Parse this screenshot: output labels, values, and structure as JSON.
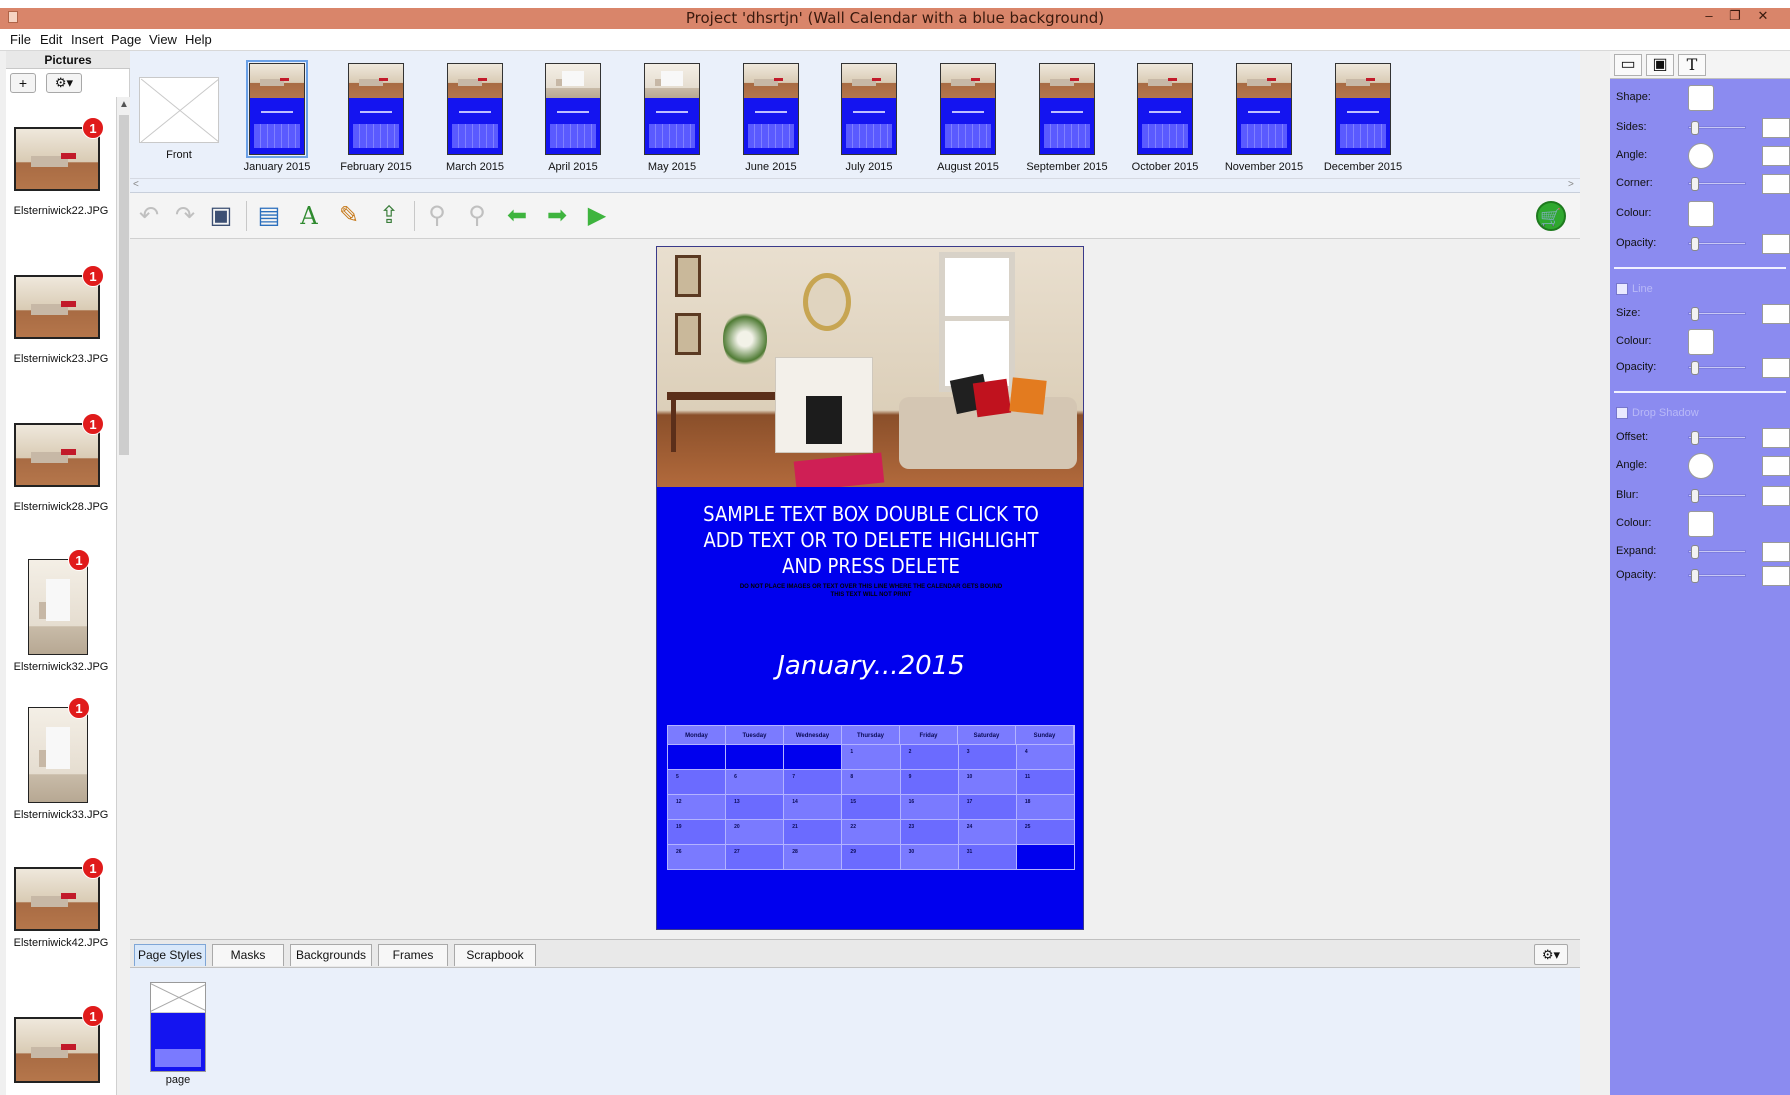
{
  "window": {
    "title": "Project 'dhsrtjn' (Wall Calendar with a blue background)",
    "minimize": "–",
    "restore": "❐",
    "close": "✕"
  },
  "menu": [
    "File",
    "Edit",
    "Insert",
    "Page",
    "View",
    "Help"
  ],
  "pictures": {
    "header": "Pictures",
    "add_label": "+",
    "gear_label": "⚙▾",
    "items": [
      {
        "name": "Elsterniwick22.JPG",
        "badge": "1"
      },
      {
        "name": "Elsterniwick23.JPG",
        "badge": "1"
      },
      {
        "name": "Elsterniwick28.JPG",
        "badge": "1"
      },
      {
        "name": "Elsterniwick32.JPG",
        "badge": "1"
      },
      {
        "name": "Elsterniwick33.JPG",
        "badge": "1"
      },
      {
        "name": "Elsterniwick42.JPG",
        "badge": "1"
      },
      {
        "name": "",
        "badge": "1"
      }
    ]
  },
  "pages": [
    "Front",
    "January 2015",
    "February 2015",
    "March 2015",
    "April 2015",
    "May 2015",
    "June 2015",
    "July 2015",
    "August 2015",
    "September 2015",
    "October 2015",
    "November 2015",
    "December 2015"
  ],
  "selected_page": "January 2015",
  "toolbar": {
    "icons": [
      "undo-icon",
      "redo-icon",
      "save-icon",
      "add-picture-icon",
      "add-text-icon",
      "edit-text-icon",
      "export-icon",
      "zoom-out-icon",
      "zoom-in-icon",
      "previous-page-icon",
      "next-page-icon",
      "play-icon",
      "cart-icon"
    ]
  },
  "calendar_page": {
    "sample_text": "SAMPLE TEXT BOX DOUBLE CLICK TO ADD TEXT OR TO DELETE HIGHLIGHT AND PRESS DELETE",
    "note_line1": "DO NOT PLACE IMAGES OR TEXT OVER THIS LINE WHERE THE CALENDAR GETS BOUND",
    "note_line2": "THIS TEXT WILL NOT PRINT",
    "month_title": "January...2015",
    "weekdays": [
      "Monday",
      "Tuesday",
      "Wednesday",
      "Thursday",
      "Friday",
      "Saturday",
      "Sunday"
    ],
    "weeks": [
      [
        "",
        "",
        "",
        "1",
        "2",
        "3",
        "4"
      ],
      [
        "5",
        "6",
        "7",
        "8",
        "9",
        "10",
        "11"
      ],
      [
        "12",
        "13",
        "14",
        "15",
        "16",
        "17",
        "18"
      ],
      [
        "19",
        "20",
        "21",
        "22",
        "23",
        "24",
        "25"
      ],
      [
        "26",
        "27",
        "28",
        "29",
        "30",
        "31",
        ""
      ]
    ],
    "background_color": "#0000ee"
  },
  "tabs": [
    "Page Styles",
    "Masks",
    "Backgrounds",
    "Frames",
    "Scrapbook"
  ],
  "active_tab": "Page Styles",
  "tabs_gear_label": "⚙▾",
  "page_styles": [
    {
      "caption": "page"
    }
  ],
  "properties": {
    "tab_icons": [
      "rectangle-icon",
      "frame-icon",
      "text-icon"
    ],
    "text_tab_label": "T",
    "shape": {
      "shape": "Shape:",
      "sides": "Sides:",
      "angle": "Angle:",
      "corner": "Corner:",
      "colour": "Colour:",
      "opacity": "Opacity:"
    },
    "line": {
      "title": "Line",
      "size": "Size:",
      "colour": "Colour:",
      "opacity": "Opacity:"
    },
    "shadow": {
      "title": "Drop Shadow",
      "offset": "Offset:",
      "angle": "Angle:",
      "blur": "Blur:",
      "colour": "Colour:",
      "expand": "Expand:",
      "opacity": "Opacity:"
    }
  },
  "colors": {
    "title_bar": "#d9856a",
    "accent_blue": "#0000ee",
    "panel_purple": "#8b8bf0",
    "badge_red": "#e01b1b"
  }
}
